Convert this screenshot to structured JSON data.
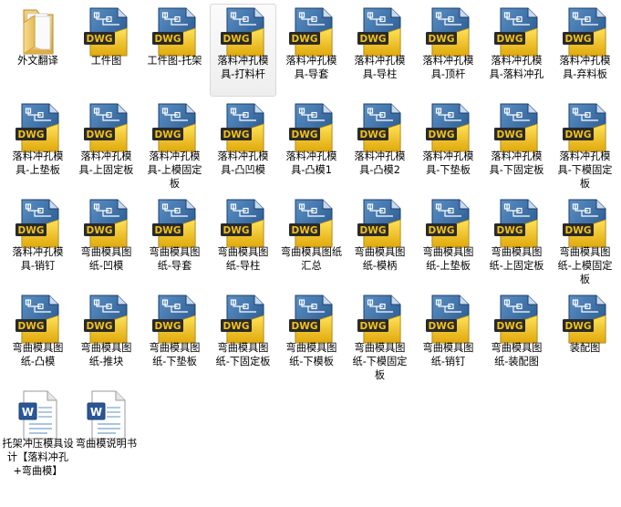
{
  "window": {
    "view": "large-icons"
  },
  "colors": {
    "selection": "#e9e9e9",
    "dwg_gold": "#f2c21a",
    "dwg_blue": "#24578e",
    "doc_blue": "#2b5797"
  },
  "items": [
    {
      "label": "外文翻译",
      "type": "folder",
      "icon": "folder-icon"
    },
    {
      "label": "工件图",
      "type": "dwg",
      "icon": "dwg-file-icon"
    },
    {
      "label": "工件图-托架",
      "type": "dwg",
      "icon": "dwg-file-icon"
    },
    {
      "label": "落料冲孔模具-打料杆",
      "type": "dwg",
      "icon": "dwg-file-icon",
      "selected": true
    },
    {
      "label": "落料冲孔模具-导套",
      "type": "dwg",
      "icon": "dwg-file-icon"
    },
    {
      "label": "落料冲孔模具-导柱",
      "type": "dwg",
      "icon": "dwg-file-icon"
    },
    {
      "label": "落料冲孔模具-顶杆",
      "type": "dwg",
      "icon": "dwg-file-icon"
    },
    {
      "label": "落料冲孔模具-落料冲孔",
      "type": "dwg",
      "icon": "dwg-file-icon"
    },
    {
      "label": "落料冲孔模具-弃料板",
      "type": "dwg",
      "icon": "dwg-file-icon"
    },
    {
      "label": "落料冲孔模具-上垫板",
      "type": "dwg",
      "icon": "dwg-file-icon"
    },
    {
      "label": "落料冲孔模具-上固定板",
      "type": "dwg",
      "icon": "dwg-file-icon"
    },
    {
      "label": "落料冲孔模具-上模固定板",
      "type": "dwg",
      "icon": "dwg-file-icon"
    },
    {
      "label": "落料冲孔模具-凸凹模",
      "type": "dwg",
      "icon": "dwg-file-icon"
    },
    {
      "label": "落料冲孔模具-凸模1",
      "type": "dwg",
      "icon": "dwg-file-icon"
    },
    {
      "label": "落料冲孔模具-凸模2",
      "type": "dwg",
      "icon": "dwg-file-icon"
    },
    {
      "label": "落料冲孔模具-下垫板",
      "type": "dwg",
      "icon": "dwg-file-icon"
    },
    {
      "label": "落料冲孔模具-下固定板",
      "type": "dwg",
      "icon": "dwg-file-icon"
    },
    {
      "label": "落料冲孔模具-下模固定板",
      "type": "dwg",
      "icon": "dwg-file-icon"
    },
    {
      "label": "落料冲孔模具-销钉",
      "type": "dwg",
      "icon": "dwg-file-icon"
    },
    {
      "label": "弯曲模具图纸-凹模",
      "type": "dwg",
      "icon": "dwg-file-icon"
    },
    {
      "label": "弯曲模具图纸-导套",
      "type": "dwg",
      "icon": "dwg-file-icon"
    },
    {
      "label": "弯曲模具图纸-导柱",
      "type": "dwg",
      "icon": "dwg-file-icon"
    },
    {
      "label": "弯曲模具图纸汇总",
      "type": "dwg",
      "icon": "dwg-file-icon"
    },
    {
      "label": "弯曲模具图纸-模柄",
      "type": "dwg",
      "icon": "dwg-file-icon"
    },
    {
      "label": "弯曲模具图纸-上垫板",
      "type": "dwg",
      "icon": "dwg-file-icon"
    },
    {
      "label": "弯曲模具图纸-上固定板",
      "type": "dwg",
      "icon": "dwg-file-icon"
    },
    {
      "label": "弯曲模具图纸-上模固定板",
      "type": "dwg",
      "icon": "dwg-file-icon"
    },
    {
      "label": "弯曲模具图纸-凸模",
      "type": "dwg",
      "icon": "dwg-file-icon"
    },
    {
      "label": "弯曲模具图纸-推块",
      "type": "dwg",
      "icon": "dwg-file-icon"
    },
    {
      "label": "弯曲模具图纸-下垫板",
      "type": "dwg",
      "icon": "dwg-file-icon"
    },
    {
      "label": "弯曲模具图纸-下固定板",
      "type": "dwg",
      "icon": "dwg-file-icon"
    },
    {
      "label": "弯曲模具图纸-下模板",
      "type": "dwg",
      "icon": "dwg-file-icon"
    },
    {
      "label": "弯曲模具图纸-下模固定板",
      "type": "dwg",
      "icon": "dwg-file-icon"
    },
    {
      "label": "弯曲模具图纸-销钉",
      "type": "dwg",
      "icon": "dwg-file-icon"
    },
    {
      "label": "弯曲模具图纸-装配图",
      "type": "dwg",
      "icon": "dwg-file-icon"
    },
    {
      "label": "装配图",
      "type": "dwg",
      "icon": "dwg-file-icon"
    },
    {
      "label": "托架冲压模具设计【落料冲孔+弯曲模】",
      "type": "doc",
      "icon": "word-doc-icon"
    },
    {
      "label": "弯曲模说明书",
      "type": "doc",
      "icon": "word-doc-icon"
    }
  ]
}
